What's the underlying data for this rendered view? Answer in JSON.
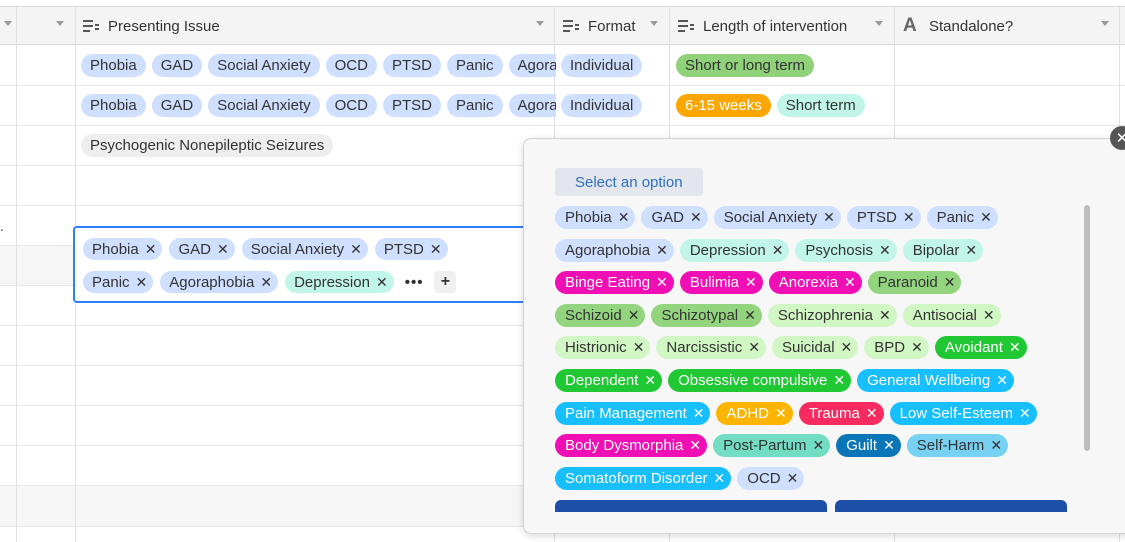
{
  "headers": [
    {
      "name": "header-presenting-issue",
      "label": "Presenting Issue",
      "icon": "multiselect-icon"
    },
    {
      "name": "header-format",
      "label": "Format",
      "icon": "multiselect-icon"
    },
    {
      "name": "header-length",
      "label": "Length of intervention",
      "icon": "multiselect-icon"
    },
    {
      "name": "header-standalone",
      "label": "Standalone?",
      "icon": "text-field-icon"
    }
  ],
  "rows": [
    {
      "issues": [
        "Phobia",
        "GAD",
        "Social Anxiety",
        "OCD",
        "PTSD",
        "Panic",
        "Agoraphobia"
      ],
      "format": [
        "Individual"
      ],
      "length": [
        {
          "label": "Short or long term",
          "color": "#8fd27a"
        }
      ]
    },
    {
      "issues": [
        "Phobia",
        "GAD",
        "Social Anxiety",
        "OCD",
        "PTSD",
        "Panic",
        "Agoraphobia"
      ],
      "format": [
        "Individual"
      ],
      "length": [
        {
          "label": "6-15 weeks",
          "color": "#fca700"
        },
        {
          "label": "Short term",
          "color": "#c2f5e9"
        }
      ]
    },
    {
      "issues": [
        "Psychogenic Nonepileptic Seizures"
      ],
      "format": [],
      "length": []
    }
  ],
  "row_marker": ".",
  "editor": {
    "line1": [
      "Phobia",
      "GAD",
      "Social Anxiety",
      "PTSD"
    ],
    "line2": [
      "Panic",
      "Agoraphobia"
    ],
    "line2_green": "Depression",
    "more_label": "•••",
    "add_label": "+"
  },
  "dropdown": {
    "select_label": "Select an option",
    "close_label": "✕",
    "options": [
      [
        {
          "label": "Phobia",
          "bg": "#cfdfff",
          "fg": "#333"
        },
        {
          "label": "GAD",
          "bg": "#cfdfff",
          "fg": "#333"
        },
        {
          "label": "Social Anxiety",
          "bg": "#cfdfff",
          "fg": "#333"
        },
        {
          "label": "PTSD",
          "bg": "#cfdfff",
          "fg": "#333"
        },
        {
          "label": "Panic",
          "bg": "#cfdfff",
          "fg": "#333"
        }
      ],
      [
        {
          "label": "Agoraphobia",
          "bg": "#cfdfff",
          "fg": "#333"
        },
        {
          "label": "Depression",
          "bg": "#c2f5e9",
          "fg": "#333"
        },
        {
          "label": "Psychosis",
          "bg": "#c2f5e9",
          "fg": "#333"
        },
        {
          "label": "Bipolar",
          "bg": "#c2f5e9",
          "fg": "#333"
        }
      ],
      [
        {
          "label": "Binge Eating",
          "bg": "#f00fb4",
          "fg": "#ffffff"
        },
        {
          "label": "Bulimia",
          "bg": "#f00fb4",
          "fg": "#ffffff"
        },
        {
          "label": "Anorexia",
          "bg": "#f00fb4",
          "fg": "#ffffff"
        },
        {
          "label": "Paranoid",
          "bg": "#93d57e",
          "fg": "#333"
        }
      ],
      [
        {
          "label": "Schizoid",
          "bg": "#93d57e",
          "fg": "#333"
        },
        {
          "label": "Schizotypal",
          "bg": "#93d57e",
          "fg": "#333"
        },
        {
          "label": "Schizophrenia",
          "bg": "#d1f7c4",
          "fg": "#333"
        },
        {
          "label": "Antisocial",
          "bg": "#d1f7c4",
          "fg": "#333"
        }
      ],
      [
        {
          "label": "Histrionic",
          "bg": "#d1f7c4",
          "fg": "#333"
        },
        {
          "label": "Narcissistic",
          "bg": "#d1f7c4",
          "fg": "#333"
        },
        {
          "label": "Suicidal",
          "bg": "#d1f7c4",
          "fg": "#333"
        },
        {
          "label": "BPD",
          "bg": "#d1f7c4",
          "fg": "#333"
        },
        {
          "label": "Avoidant",
          "bg": "#20c933",
          "fg": "#ffffff"
        }
      ],
      [
        {
          "label": "Dependent",
          "bg": "#20c933",
          "fg": "#ffffff"
        },
        {
          "label": "Obsessive compulsive",
          "bg": "#20c933",
          "fg": "#ffffff"
        },
        {
          "label": "General Wellbeing",
          "bg": "#18bfff",
          "fg": "#ffffff"
        }
      ],
      [
        {
          "label": "Pain Management",
          "bg": "#18bfff",
          "fg": "#ffffff"
        },
        {
          "label": "ADHD",
          "bg": "#fcb400",
          "fg": "#ffffff"
        },
        {
          "label": "Trauma",
          "bg": "#f82b60",
          "fg": "#ffffff"
        },
        {
          "label": "Low Self-Esteem",
          "bg": "#18bfff",
          "fg": "#ffffff"
        }
      ],
      [
        {
          "label": "Body Dysmorphia",
          "bg": "#f00fb4",
          "fg": "#ffffff"
        },
        {
          "label": "Post-Partum",
          "bg": "#72ddc3",
          "fg": "#333"
        },
        {
          "label": "Guilt",
          "bg": "#0b76b7",
          "fg": "#ffffff"
        },
        {
          "label": "Self-Harm",
          "bg": "#77d1f3",
          "fg": "#333"
        }
      ],
      [
        {
          "label": "Somatoform Disorder",
          "bg": "#18bfff",
          "fg": "#ffffff"
        },
        {
          "label": "OCD",
          "bg": "#cfdfff",
          "fg": "#333"
        }
      ]
    ]
  },
  "colors": {
    "issue_pill": "#cfdfff",
    "format_pill": "#cfdfff",
    "psychogenic_pill": "#eeeeee",
    "editor_border": "#2d7ff9",
    "editor_green": "#c2f5e9"
  }
}
